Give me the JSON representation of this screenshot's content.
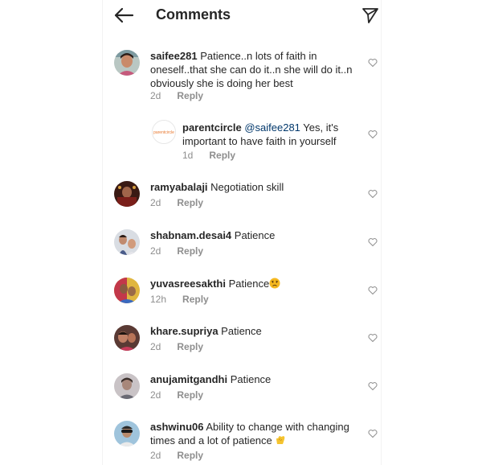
{
  "header": {
    "title": "Comments"
  },
  "comments": [
    {
      "username": "saifee281",
      "text": "Patience..n lots of faith in oneself..that she can do it..n she will do it..n obviously she is doing her best",
      "time": "2d",
      "reply_label": "Reply"
    },
    {
      "username": "parentcircle",
      "mention": "@saifee281",
      "text": "Yes, it's important to have faith in yourself",
      "time": "1d",
      "reply_label": "Reply",
      "avatar_logo_text": "parentcircle"
    },
    {
      "username": "ramyabalaji",
      "text": "Negotiation skill",
      "time": "2d",
      "reply_label": "Reply"
    },
    {
      "username": "shabnam.desai4",
      "text": "Patience",
      "time": "2d",
      "reply_label": "Reply"
    },
    {
      "username": "yuvasreesakthi",
      "text": "Patience",
      "emoji": "sad-face-emoji",
      "time": "12h",
      "reply_label": "Reply"
    },
    {
      "username": "khare.supriya",
      "text": "Patience",
      "time": "2d",
      "reply_label": "Reply"
    },
    {
      "username": "anujamitgandhi",
      "text": "Patience",
      "time": "2d",
      "reply_label": "Reply"
    },
    {
      "username": "ashwinu06",
      "text": "Ability to change with changing times and a lot of patience",
      "emoji": "clapping-hands-emoji",
      "time": "2d",
      "reply_label": "Reply"
    }
  ],
  "icons": {
    "back": "arrow-left-icon",
    "send": "paper-plane-icon",
    "like": "heart-outline-icon"
  },
  "colors": {
    "text": "#262626",
    "secondary": "#8e8e8e",
    "mention": "#00376b"
  }
}
